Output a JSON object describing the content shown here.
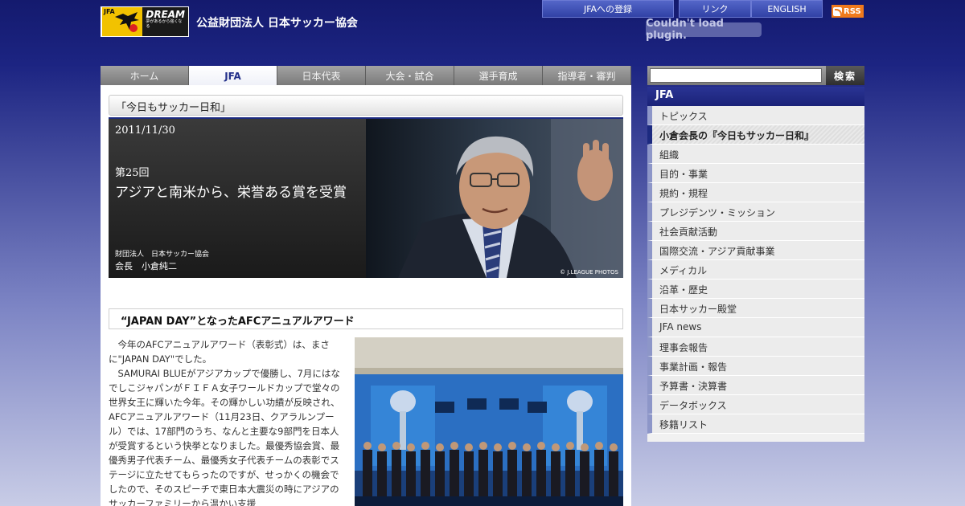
{
  "header": {
    "logo_mark": "JFA",
    "logo_text": "DREAM",
    "logo_tagline": "夢があるから強くなる",
    "org_name": "公益財団法人 日本サッカー協会",
    "links": [
      "JFAへの登録",
      "リンク",
      "ENGLISH"
    ],
    "rss": "RSS",
    "plugin_message": "Couldn't load plugin."
  },
  "nav": {
    "tabs": [
      "ホーム",
      "JFA",
      "日本代表",
      "大会・試合",
      "選手育成",
      "指導者・審判"
    ],
    "active_index": 1
  },
  "main": {
    "section_title": "「今日もサッカー日和」",
    "hero": {
      "date": "2011/11/30",
      "volume": "第25回",
      "title": "アジアと南米から、栄誉ある賞を受賞",
      "org": "財団法人　日本サッカー協会",
      "person": "会長　小倉純二",
      "credit": "© J.LEAGUE PHOTOS"
    },
    "article": {
      "title": "“JAPAN DAY”となったAFCアニュアルアワード",
      "p1": "今年のAFCアニュアルアワード（表彰式）は、まさに\"JAPAN DAY\"でした。",
      "p2": "SAMURAI BLUEがアジアカップで優勝し、7月にはなでしこジャパンがＦＩＦＡ女子ワールドカップで堂々の世界女王に輝いた今年。その輝かしい功績が反映され、AFCアニュアルアワード（11月23日、クアラルンプール）では、17部門のうち、なんと主要な9部門を日本人が受賞するという快挙となりました。最優秀協会賞、最優秀男子代表チーム、最優秀女子代表チームの表彰でステージに立たせてもらったのですが、せっかくの機会でしたので、そのスピーチで東日本大震災の時にアジアのサッカーファミリーから温かい支援"
    }
  },
  "sidebar": {
    "search_button": "検索",
    "search_value": "",
    "menu_title": "JFA",
    "items": [
      "トピックス",
      "小倉会長の『今日もサッカー日和』",
      "組織",
      "目的・事業",
      "規約・規程",
      "プレジデンツ・ミッション",
      "社会貢献活動",
      "国際交流・アジア貢献事業",
      "メディカル",
      "沿革・歴史",
      "日本サッカー殿堂",
      "JFA news",
      "理事会報告",
      "事業計画・報告",
      "予算書・決算書",
      "データボックス",
      "移籍リスト"
    ],
    "current_index": 1
  },
  "colors": {
    "brand_navy": "#1c2a80",
    "nav_gray": "#8a8a8a",
    "rss_orange": "#f07a1c",
    "logo_yellow": "#f2c200"
  }
}
